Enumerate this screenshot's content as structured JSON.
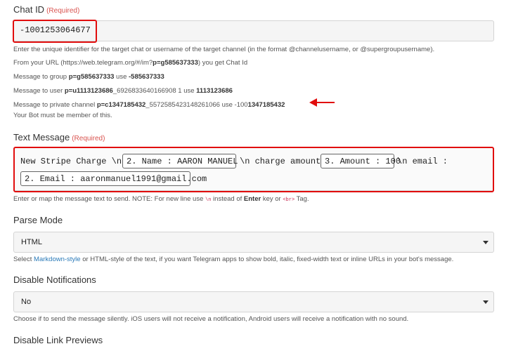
{
  "chat_id": {
    "label": "Chat ID",
    "required": "(Required)",
    "value": "-1001253064677",
    "help": [
      "Enter the unique identifier for the target chat or username of the target channel (in the format @channelusername, or @supergroupusername).",
      "From your URL (https://web.telegram.org/#/im?p=g585637333) you get Chat Id",
      "Message to group p=g585637333 use -585637333",
      "Message to user p=u1113123686_6926833640166908 1 use 1113123686",
      "Message to private channel p=c1347185432_5572585423148261066 use -1001347185432",
      "Your Bot must be member of this."
    ],
    "help_parts": {
      "url_prefix": "From your URL (https://web.telegram.org/#/im?",
      "url_bold": "p=g585637333",
      "url_suffix": ") you get Chat Id",
      "group_prefix": "Message to group ",
      "group_bold": "p=g585637333",
      "group_mid": " use ",
      "group_value": "-585637333",
      "user_prefix": "Message to user ",
      "user_bold": "p=u1113123686",
      "user_rest": "_6926833640166908 1 use ",
      "user_value": "1113123686",
      "private_prefix": "Message to private channel ",
      "private_bold": "p=c1347185432",
      "private_rest": "_5572585423148261066 use -100",
      "private_value": "1347185432",
      "member": "Your Bot must be member of this."
    }
  },
  "text_message": {
    "label": "Text Message",
    "required": "(Required)",
    "seg1": "New Stripe Charge \\n by",
    "chip1": "2. Name : AARON MANUEL",
    "seg2": "\\n charge amount :",
    "chip2": "3. Amount : 100",
    "seg3": "\\n email :",
    "chip3": "2. Email : aaronmanuel1991@gmail.com",
    "help_prefix": "Enter or map the message text to send. NOTE: For new line use ",
    "help_code1": "\\n",
    "help_mid": " instead of ",
    "help_bold": "Enter",
    "help_mid2": " key or ",
    "help_code2": "<br>",
    "help_suffix": " Tag."
  },
  "parse_mode": {
    "label": "Parse Mode",
    "value": "HTML",
    "help_prefix": "Select ",
    "help_link": "Markdown-style",
    "help_suffix": " or HTML-style of the text, if you want Telegram apps to show bold, italic, fixed-width text or inline URLs in your bot's message."
  },
  "disable_notifications": {
    "label": "Disable Notifications",
    "value": "No",
    "help": "Choose if to send the message silently. iOS users will not receive a notification, Android users will receive a notification with no sound."
  },
  "disable_link_previews": {
    "label": "Disable Link Previews"
  },
  "colors": {
    "highlight": "#e10d0d",
    "required": "#d9534f",
    "link": "#2a7ab8"
  }
}
